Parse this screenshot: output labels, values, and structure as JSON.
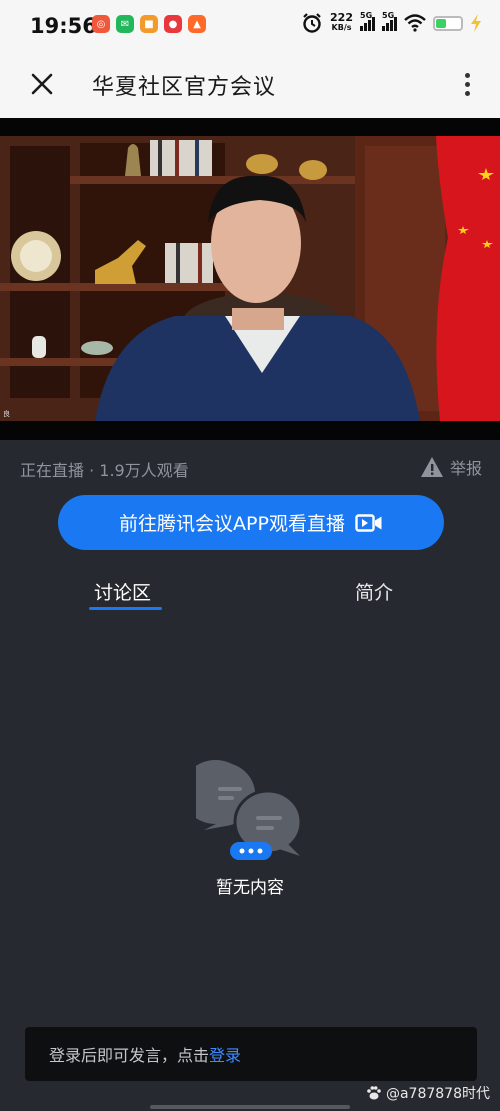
{
  "status_bar": {
    "time": "19:56",
    "net_speed_value": "222",
    "net_speed_unit": "KB/s",
    "sim1": "5G",
    "sim2": "5G",
    "battery_level": 0.4,
    "app_icons": [
      "app-icon-1",
      "wechat-icon",
      "app-icon-3",
      "app-icon-4",
      "app-icon-5"
    ]
  },
  "header": {
    "title": "华夏社区官方会议"
  },
  "video": {
    "overlay_text": "良"
  },
  "info": {
    "live_status": "正在直播 · 1.9万人观看",
    "report_label": "举报",
    "cta_label": "前往腾讯会议APP观看直播"
  },
  "tabs": [
    {
      "label": "讨论区",
      "active": true
    },
    {
      "label": "简介",
      "active": false
    }
  ],
  "empty_state": {
    "text": "暂无内容"
  },
  "login_bar": {
    "text": "登录后即可发言，点击",
    "link": "登录"
  },
  "watermark": {
    "text": "@a787878时代"
  },
  "colors": {
    "accent": "#1a78f2",
    "background": "#26292f",
    "header_bg": "#f6f6f7"
  }
}
